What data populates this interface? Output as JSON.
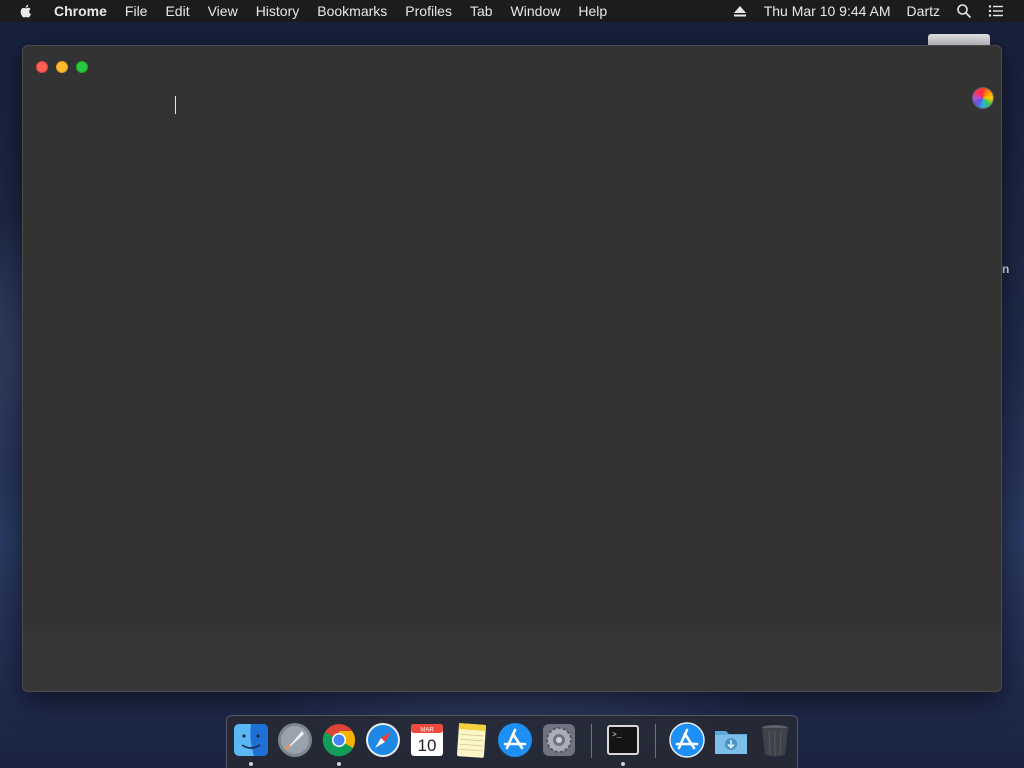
{
  "menubar": {
    "app_name": "Chrome",
    "items": [
      "File",
      "Edit",
      "View",
      "History",
      "Bookmarks",
      "Profiles",
      "Tab",
      "Window",
      "Help"
    ],
    "clock": "Thu Mar 10  9:44 AM",
    "user": "Dartz",
    "icons": [
      "apple-icon",
      "eject-icon",
      "spotlight-search-icon",
      "notification-center-icon"
    ]
  },
  "desktop": {
    "partial_label": "n"
  },
  "window": {
    "app": "Chrome",
    "controls": [
      "close",
      "minimize",
      "zoom"
    ],
    "background_color": "#333334"
  },
  "dock": {
    "items": [
      {
        "name": "Finder",
        "icon": "finder-icon",
        "running": true
      },
      {
        "name": "Launchpad",
        "icon": "launchpad-icon",
        "running": false
      },
      {
        "name": "Google Chrome",
        "icon": "chrome-icon",
        "running": true
      },
      {
        "name": "Safari",
        "icon": "safari-icon",
        "running": false
      },
      {
        "name": "Calendar",
        "icon": "calendar-icon",
        "running": false,
        "month": "MAR",
        "day": "10"
      },
      {
        "name": "Notes",
        "icon": "notes-icon",
        "running": false
      },
      {
        "name": "App Store",
        "icon": "app-store-icon",
        "running": false
      },
      {
        "name": "System Preferences",
        "icon": "system-preferences-icon",
        "running": false
      },
      {
        "name": "Terminal",
        "icon": "terminal-icon",
        "running": true,
        "prompt": ">_"
      },
      {
        "name": "Applications",
        "icon": "applications-folder-icon",
        "running": false
      },
      {
        "name": "Downloads",
        "icon": "downloads-folder-icon",
        "running": false
      },
      {
        "name": "Trash",
        "icon": "trash-icon",
        "running": false
      }
    ]
  }
}
